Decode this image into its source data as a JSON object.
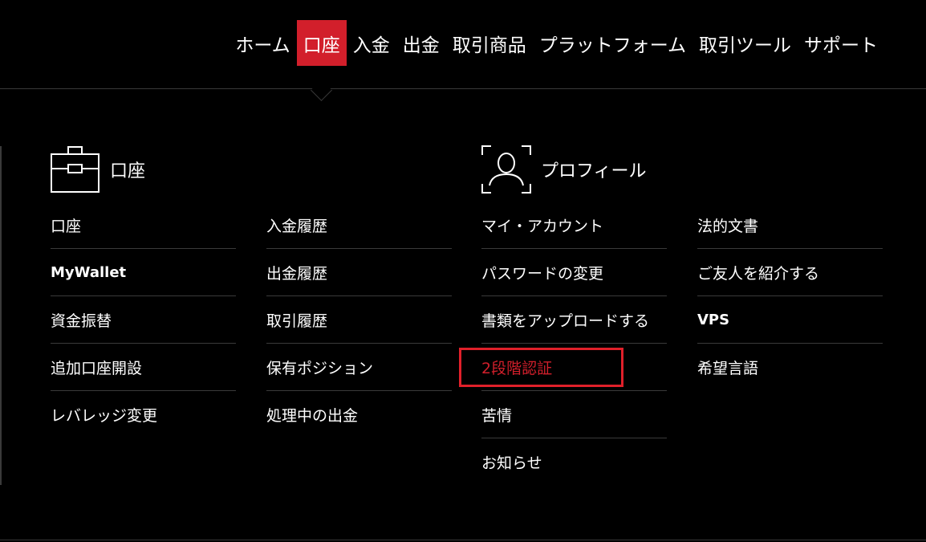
{
  "nav": {
    "items": [
      "ホーム",
      "口座",
      "入金",
      "出金",
      "取引商品",
      "プラットフォーム",
      "取引ツール",
      "サポート"
    ]
  },
  "account_section": {
    "title": "口座",
    "icon": "briefcase-icon",
    "col1": [
      "口座",
      "MyWallet",
      "資金振替",
      "追加口座開設",
      "レバレッジ変更"
    ],
    "col2": [
      "入金履歴",
      "出金履歴",
      "取引履歴",
      "保有ポジション",
      "処理中の出金"
    ]
  },
  "profile_section": {
    "title": "プロフィール",
    "icon": "user-profile-icon",
    "col3": [
      "マイ・アカウント",
      "パスワードの変更",
      "書類をアップロードする",
      "2段階認証",
      "苦情",
      "お知らせ"
    ],
    "col4": [
      "法的文書",
      "ご友人を紹介する",
      "VPS",
      "希望言語"
    ]
  },
  "colors": {
    "accent": "#d21f2b",
    "highlight_box": "#e0202a",
    "background": "#000000",
    "divider": "#3a3a3a"
  }
}
